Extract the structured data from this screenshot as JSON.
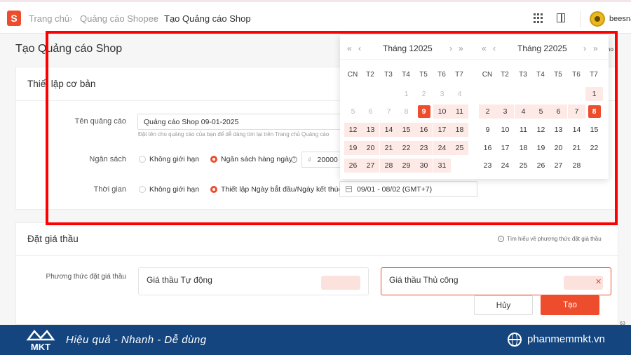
{
  "header": {
    "breadcrumb": [
      "Trang chủ",
      "Quảng cáo Shopee",
      "Tạo Quảng cáo Shop"
    ],
    "username": "beesna",
    "logo_letter": "S"
  },
  "page": {
    "title": "Tạo Quảng cáo Shop"
  },
  "basic": {
    "title": "Thiết lập cơ bản",
    "name_label": "Tên quảng cáo",
    "name_value": "Quảng cáo Shop 09-01-2025",
    "name_hint": "Đặt tên cho quảng cáo của bạn để dễ dàng tìm lại trên Trang chủ Quảng cáo",
    "budget_label": "Ngân sách",
    "budget_unlimited": "Không giới hạn",
    "budget_daily": "Ngân sách hàng ngày",
    "currency": "₫",
    "budget_value": "20000",
    "time_label": "Thời gian",
    "time_unlimited": "Không giới hạn",
    "time_set": "Thiết lập Ngày bắt đầu/Ngày kết thúc",
    "date_range": "09/01 - 08/02 (GMT+7)"
  },
  "calendar": {
    "weekdays": [
      "CN",
      "T2",
      "T3",
      "T4",
      "T5",
      "T6",
      "T7"
    ],
    "month1_title": "Tháng 12025",
    "month2_title": "Tháng 22025",
    "nav_prev_year": "«",
    "nav_prev": "‹",
    "nav_next": "›",
    "nav_next_year": "»"
  },
  "bidding": {
    "title": "Đặt giá thầu",
    "learn_more": "Tìm hiểu về phương thức đặt giá thầu",
    "method_label": "Phương thức đặt giá thầu",
    "auto": "Giá thầu Tự động",
    "manual": "Giá thầu Thủ công"
  },
  "footer": {
    "cancel": "Hủy",
    "create": "Tạo"
  },
  "edge_text": "ho",
  "banner": {
    "brand": "MKT",
    "slogan": "Hiệu quả - Nhanh - Dễ dùng",
    "site": "phanmemmkt.vn"
  },
  "colors": {
    "accent": "#ee4d2d",
    "range": "#fde9e5",
    "highlight_box": "#ff0000",
    "banner": "#14457f"
  }
}
